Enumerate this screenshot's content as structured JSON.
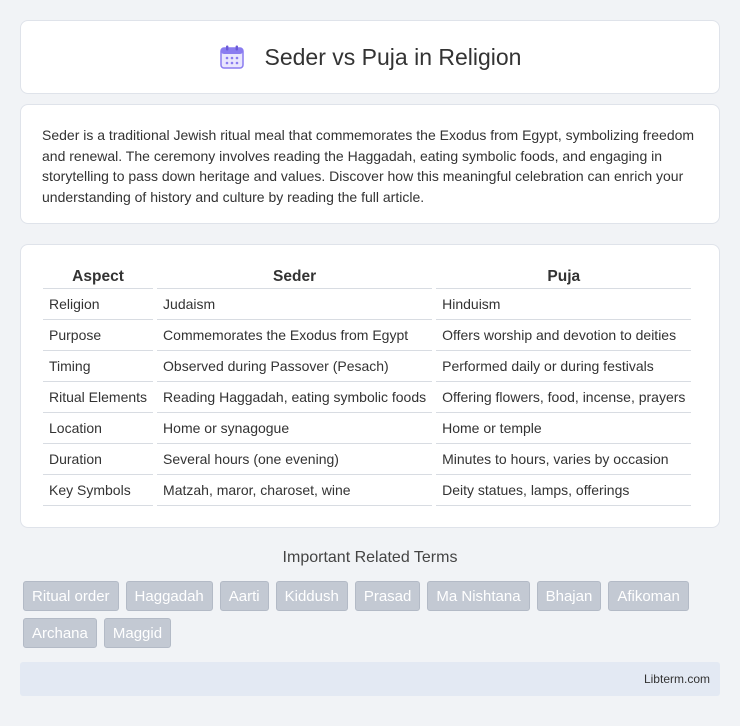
{
  "header": {
    "title": "Seder vs Puja in Religion",
    "icon": "calendar-icon",
    "icon_color": "#8a7cf0"
  },
  "intro": {
    "text": "Seder is a traditional Jewish ritual meal that commemorates the Exodus from Egypt, symbolizing freedom and renewal. The ceremony involves reading the Haggadah, eating symbolic foods, and engaging in storytelling to pass down heritage and values. Discover how this meaningful celebration can enrich your understanding of history and culture by reading the full article."
  },
  "comparison": {
    "headers": [
      "Aspect",
      "Seder",
      "Puja"
    ],
    "rows": [
      [
        "Religion",
        "Judaism",
        "Hinduism"
      ],
      [
        "Purpose",
        "Commemorates the Exodus from Egypt",
        "Offers worship and devotion to deities"
      ],
      [
        "Timing",
        "Observed during Passover (Pesach)",
        "Performed daily or during festivals"
      ],
      [
        "Ritual Elements",
        "Reading Haggadah, eating symbolic foods",
        "Offering flowers, food, incense, prayers"
      ],
      [
        "Location",
        "Home or synagogue",
        "Home or temple"
      ],
      [
        "Duration",
        "Several hours (one evening)",
        "Minutes to hours, varies by occasion"
      ],
      [
        "Key Symbols",
        "Matzah, maror, charoset, wine",
        "Deity statues, lamps, offerings"
      ]
    ]
  },
  "related": {
    "title": "Important Related Terms",
    "tags": [
      "Ritual order",
      "Haggadah",
      "Aarti",
      "Kiddush",
      "Prasad",
      "Ma Nishtana",
      "Bhajan",
      "Afikoman",
      "Archana",
      "Maggid"
    ]
  },
  "footer": {
    "text": "Libterm.com"
  },
  "colors": {
    "background": "#f1f3f6",
    "tag_bg": "#c3c9d3",
    "footer_bg": "#e3e9f3"
  }
}
